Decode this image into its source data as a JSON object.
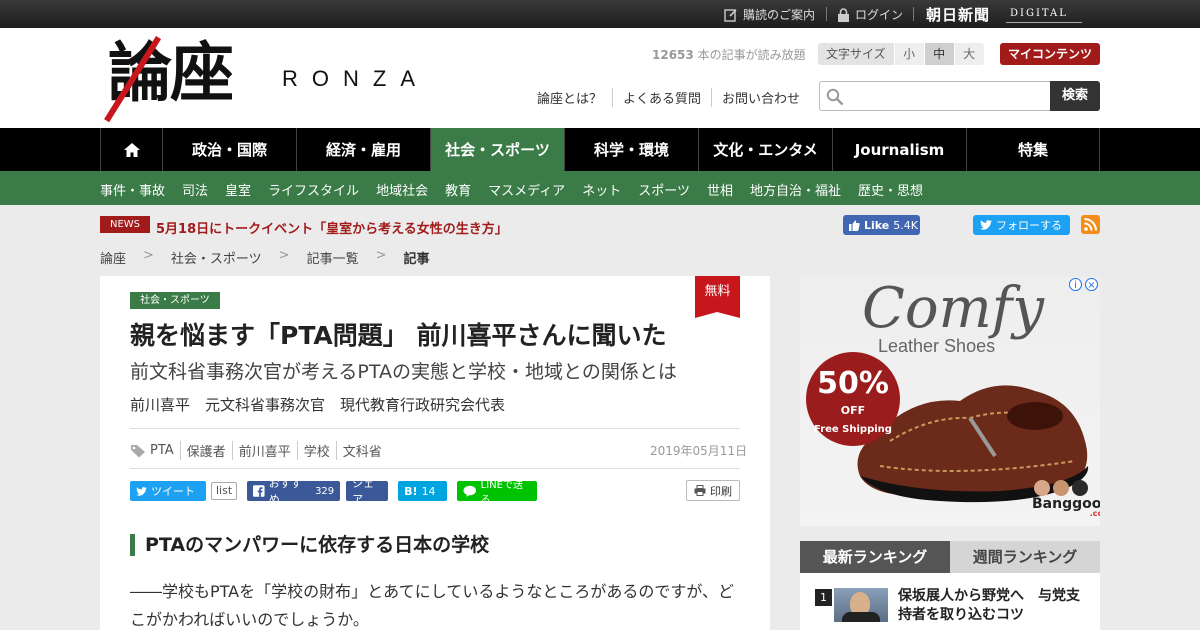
{
  "topbar": {
    "subscribe": "購読のご案内",
    "login": "ログイン",
    "asahi": "朝日新聞",
    "digital": "DIGITAL"
  },
  "header": {
    "logo_kanji": "論座",
    "logo_latin": "RONZA",
    "read_count": "12653",
    "read_count_suffix": " 本の記事が読み放題",
    "font_size_label": "文字サイズ",
    "font_sizes": [
      "小",
      "中",
      "大"
    ],
    "font_size_selected": "中",
    "my_content": "マイコンテンツ",
    "links": [
      "論座とは？",
      "よくある質問",
      "お問い合わせ"
    ],
    "search_placeholder": "",
    "search_button": "検索"
  },
  "main_nav": [
    {
      "label": "⌂",
      "width": "home"
    },
    {
      "label": "政治・国際"
    },
    {
      "label": "経済・雇用"
    },
    {
      "label": "社会・スポーツ",
      "active": true
    },
    {
      "label": "科学・環境"
    },
    {
      "label": "文化・エンタメ"
    },
    {
      "label": "Journalism"
    },
    {
      "label": "特集"
    }
  ],
  "sub_nav": [
    "事件・事故",
    "司法",
    "皇室",
    "ライフスタイル",
    "地域社会",
    "教育",
    "マスメディア",
    "ネット",
    "スポーツ",
    "世相",
    "地方自治・福祉",
    "歴史・思想"
  ],
  "news": {
    "badge": "NEWS",
    "text": "5月18日にトークイベント「皇室から考える女性の生き方」"
  },
  "social": {
    "fb_like": "Like",
    "fb_like_count": "5.4K",
    "tw_follow": "フォローする"
  },
  "breadcrumb": [
    "論座",
    "社会・スポーツ",
    "記事一覧",
    "記事"
  ],
  "article": {
    "category": "社会・スポーツ",
    "free_badge": "無料",
    "title": "親を悩ます「PTA問題」 前川喜平さんに聞いた",
    "subtitle": "前文科省事務次官が考えるPTAの実態と学校・地域との関係とは",
    "author": "前川喜平　元文科省事務次官　現代教育行政研究会代表",
    "tags": [
      "PTA",
      "保護者",
      "前川喜平",
      "学校",
      "文科省"
    ],
    "date": "2019年05月11日",
    "share": {
      "tweet": "ツイート",
      "list": "list",
      "fb_recommend": "おすすめ",
      "fb_recommend_count": "329",
      "fb_share": "シェア",
      "hatena_label": "B!",
      "hatena_count": "14",
      "line": "LINEで送る",
      "print": "印刷"
    },
    "section_heading": "PTAのマンパワーに依存する日本の学校",
    "body": "――学校もPTAを「学校の財布」とあてにしているようなところがあるのですが、どこがかわればいいのでしょうか。"
  },
  "ad": {
    "title": "Comfy",
    "subtitle": "Leather Shoes",
    "discount": "50%",
    "discount_off": "OFF",
    "shipping": "Free Shipping",
    "brand": "Banggood",
    "brand_suffix": ".com"
  },
  "ranking": {
    "tabs": [
      "最新ランキング",
      "週間ランキング"
    ],
    "active_tab": "最新ランキング",
    "items": [
      {
        "rank": "1",
        "title": "保坂展人から野党へ　与党支持者を取り込むコツ"
      }
    ]
  },
  "colors": {
    "accent_green": "#3a7b47",
    "accent_red": "#a11b1b",
    "nav_black": "#000000"
  }
}
